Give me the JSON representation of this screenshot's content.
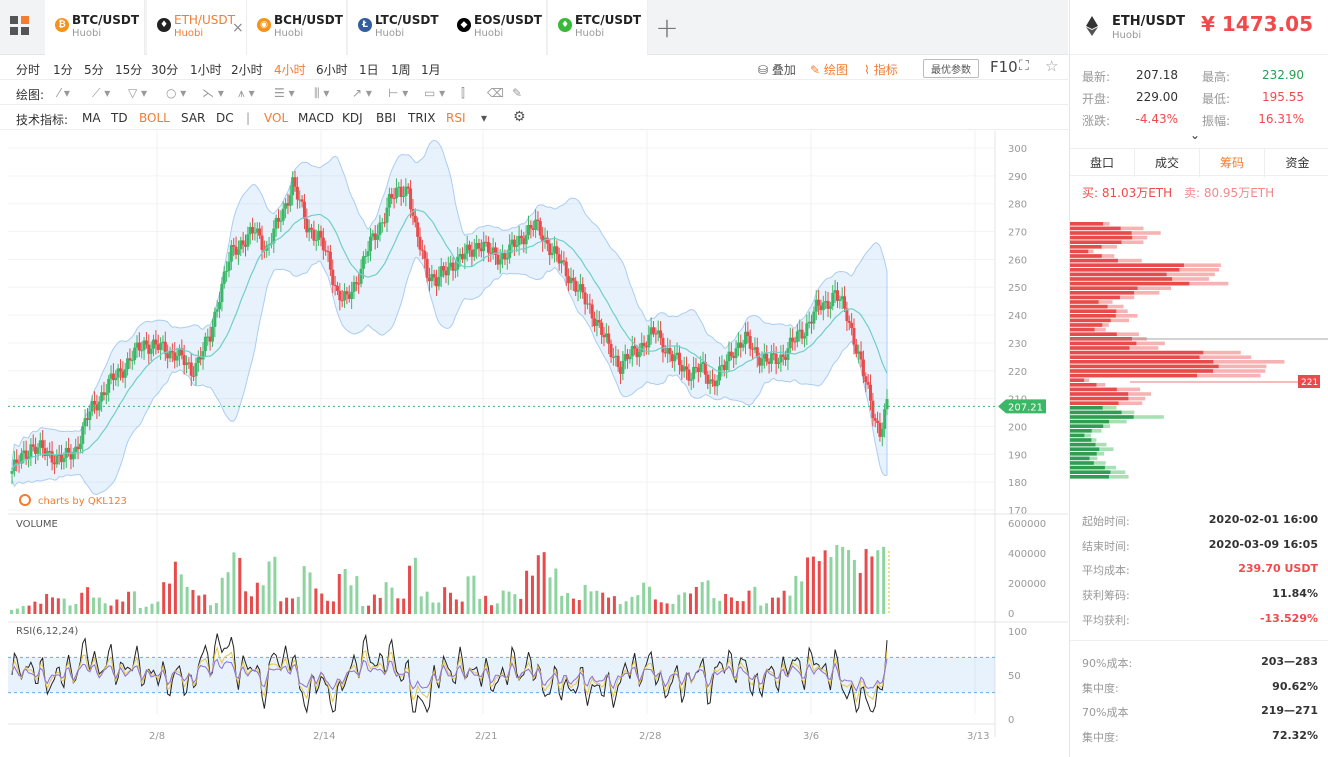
{
  "tabs": [
    {
      "symbol": "BTC/USDT",
      "exchange": "Huobi",
      "icon": "btc-coin-icon",
      "color": "#f7931a",
      "glyph": "₿",
      "active": false
    },
    {
      "symbol": "ETH/USDT",
      "exchange": "Huobi",
      "icon": "eth-coin-icon",
      "color": "#222222",
      "glyph": "♦",
      "active": true
    },
    {
      "symbol": "BCH/USDT",
      "exchange": "Huobi",
      "icon": "bch-coin-icon",
      "color": "#f7931a",
      "glyph": "◉",
      "active": false
    },
    {
      "symbol": "LTC/USDT",
      "exchange": "Huobi",
      "icon": "ltc-coin-icon",
      "color": "#345d9d",
      "glyph": "Ł",
      "active": false
    },
    {
      "symbol": "EOS/USDT",
      "exchange": "Huobi",
      "icon": "eos-coin-icon",
      "color": "#000000",
      "glyph": "◆",
      "active": false
    },
    {
      "symbol": "ETC/USDT",
      "exchange": "Huobi",
      "icon": "etc-coin-icon",
      "color": "#3ab83a",
      "glyph": "♦",
      "active": false
    }
  ],
  "toolbar": {
    "intervals": [
      "分时",
      "1分",
      "5分",
      "15分",
      "30分",
      "1小时",
      "2小时",
      "4小时",
      "6小时",
      "1日",
      "1周",
      "1月"
    ],
    "active_interval": "4小时",
    "overlay": "叠加",
    "draw": "绘图",
    "indicator": "指标",
    "best_params": "最优参数",
    "f10": "F10",
    "draw_label": "绘图:",
    "indicator_label": "技术指标:",
    "indicators": [
      "MA",
      "TD",
      "BOLL",
      "SAR",
      "DC",
      "|",
      "VOL",
      "MACD",
      "KDJ",
      "BBI",
      "TRIX",
      "RSI"
    ],
    "active_indicators": [
      "BOLL",
      "VOL",
      "RSI"
    ]
  },
  "chart_data": {
    "type": "candlestick",
    "symbol": "ETH/USDT",
    "interval": "4h",
    "price_ylim": [
      170,
      300
    ],
    "price_ticks": [
      300,
      290,
      280,
      270,
      260,
      250,
      240,
      230,
      220,
      210,
      200,
      190,
      180,
      170
    ],
    "last_price": "207.21",
    "cursor_label": "221",
    "volume_label": "VOLUME",
    "volume_ticks": [
      "600000",
      "400000",
      "200000",
      "0"
    ],
    "volume_ylim": [
      0,
      600000
    ],
    "rsi_label": "RSI(6,12,24)",
    "rsi_ticks": [
      "100",
      "50",
      "0"
    ],
    "rsi_bands": [
      70,
      30
    ],
    "x_ticks": [
      "2/8",
      "2/14",
      "2/21",
      "2/28",
      "3/6",
      "3/13"
    ],
    "watermark": "charts by QKL123",
    "anchors": [
      [
        0,
        184
      ],
      [
        8,
        193
      ],
      [
        16,
        190
      ],
      [
        22,
        188
      ],
      [
        27,
        192
      ],
      [
        33,
        205
      ],
      [
        40,
        214
      ],
      [
        48,
        222
      ],
      [
        56,
        230
      ],
      [
        63,
        228
      ],
      [
        70,
        226
      ],
      [
        76,
        220
      ],
      [
        79,
        224
      ],
      [
        84,
        232
      ],
      [
        88,
        248
      ],
      [
        93,
        262
      ],
      [
        97,
        266
      ],
      [
        103,
        270
      ],
      [
        108,
        264
      ],
      [
        115,
        277
      ],
      [
        119,
        288
      ],
      [
        125,
        272
      ],
      [
        130,
        268
      ],
      [
        134,
        260
      ],
      [
        138,
        248
      ],
      [
        142,
        245
      ],
      [
        145,
        250
      ],
      [
        150,
        262
      ],
      [
        155,
        270
      ],
      [
        160,
        281
      ],
      [
        164,
        284
      ],
      [
        168,
        286
      ],
      [
        171,
        270
      ],
      [
        176,
        256
      ],
      [
        180,
        252
      ],
      [
        186,
        258
      ],
      [
        193,
        262
      ],
      [
        198,
        266
      ],
      [
        203,
        262
      ],
      [
        209,
        261
      ],
      [
        214,
        266
      ],
      [
        218,
        270
      ],
      [
        222,
        272
      ],
      [
        227,
        266
      ],
      [
        233,
        258
      ],
      [
        238,
        252
      ],
      [
        243,
        245
      ],
      [
        248,
        238
      ],
      [
        253,
        228
      ],
      [
        258,
        222
      ],
      [
        263,
        226
      ],
      [
        268,
        230
      ],
      [
        273,
        234
      ],
      [
        278,
        227
      ],
      [
        283,
        222
      ],
      [
        288,
        219
      ],
      [
        292,
        221
      ],
      [
        297,
        216
      ],
      [
        302,
        221
      ],
      [
        306,
        228
      ],
      [
        311,
        231
      ],
      [
        316,
        226
      ],
      [
        321,
        223
      ],
      [
        326,
        225
      ],
      [
        331,
        230
      ],
      [
        336,
        235
      ],
      [
        341,
        242
      ],
      [
        345,
        244
      ],
      [
        349,
        248
      ],
      [
        354,
        240
      ],
      [
        357,
        232
      ],
      [
        360,
        222
      ],
      [
        363,
        212
      ],
      [
        366,
        203
      ],
      [
        368,
        198
      ],
      [
        371,
        207
      ]
    ],
    "volume_levels": [
      0.06,
      0.1,
      0.14,
      0.22,
      0.18,
      0.11,
      0.3,
      0.2,
      0.12,
      0.16,
      0.26,
      0.08,
      0.14,
      0.38,
      0.58,
      0.3,
      0.22,
      0.12,
      0.48,
      0.72,
      0.25,
      0.35,
      0.64,
      0.18,
      0.2,
      0.55,
      0.28,
      0.15,
      0.5,
      0.42,
      0.1,
      0.22,
      0.35,
      0.18,
      0.62,
      0.25,
      0.14,
      0.3,
      0.16,
      0.44,
      0.2,
      0.12,
      0.28,
      0.22,
      0.48,
      0.7,
      0.5,
      0.24,
      0.18,
      0.32,
      0.26,
      0.2,
      0.14,
      0.22,
      0.36,
      0.16,
      0.12,
      0.24,
      0.3,
      0.4,
      0.18,
      0.22,
      0.15,
      0.3,
      0.12,
      0.2,
      0.26,
      0.42,
      0.66,
      0.7,
      0.78,
      0.8,
      0.6,
      0.72,
      0.76
    ]
  },
  "panel": {
    "symbol": "ETH/USDT",
    "exchange": "Huobi",
    "price": "¥ 1473.05",
    "stats": [
      {
        "label": "最新:",
        "value": "207.18",
        "color": "#333333"
      },
      {
        "label": "最高:",
        "value": "232.90",
        "color": "#27a04e"
      },
      {
        "label": "开盘:",
        "value": "229.00",
        "color": "#333333"
      },
      {
        "label": "最低:",
        "value": "195.55",
        "color": "#f04a4a"
      },
      {
        "label": "涨跌:",
        "value": "-4.43%",
        "color": "#f04a4a"
      },
      {
        "label": "振幅:",
        "value": "16.31%",
        "color": "#f04a4a"
      }
    ],
    "tabs": [
      "盘口",
      "成交",
      "筹码",
      "资金"
    ],
    "active_tab": "筹码",
    "buy": "买: 81.03万ETH",
    "sell": "卖: 80.95万ETH",
    "info": [
      {
        "label": "起始时间:",
        "value": "2020-02-01 16:00",
        "color": "#333333"
      },
      {
        "label": "结束时间:",
        "value": "2020-03-09 16:05",
        "color": "#333333"
      },
      {
        "label": "平均成本:",
        "value": "239.70 USDT",
        "color": "#f04a4a"
      },
      {
        "label": "获利筹码:",
        "value": "11.84%",
        "color": "#333333"
      },
      {
        "label": "平均获利:",
        "value": "-13.529%",
        "color": "#f04a4a"
      },
      {
        "label": "90%成本:",
        "value": "203—283",
        "color": "#333333"
      },
      {
        "label": "集中度:",
        "value": "90.62%",
        "color": "#333333"
      },
      {
        "label": "70%成本",
        "value": "219—271",
        "color": "#333333"
      },
      {
        "label": "集中度:",
        "value": "72.32%",
        "color": "#333333"
      }
    ]
  }
}
